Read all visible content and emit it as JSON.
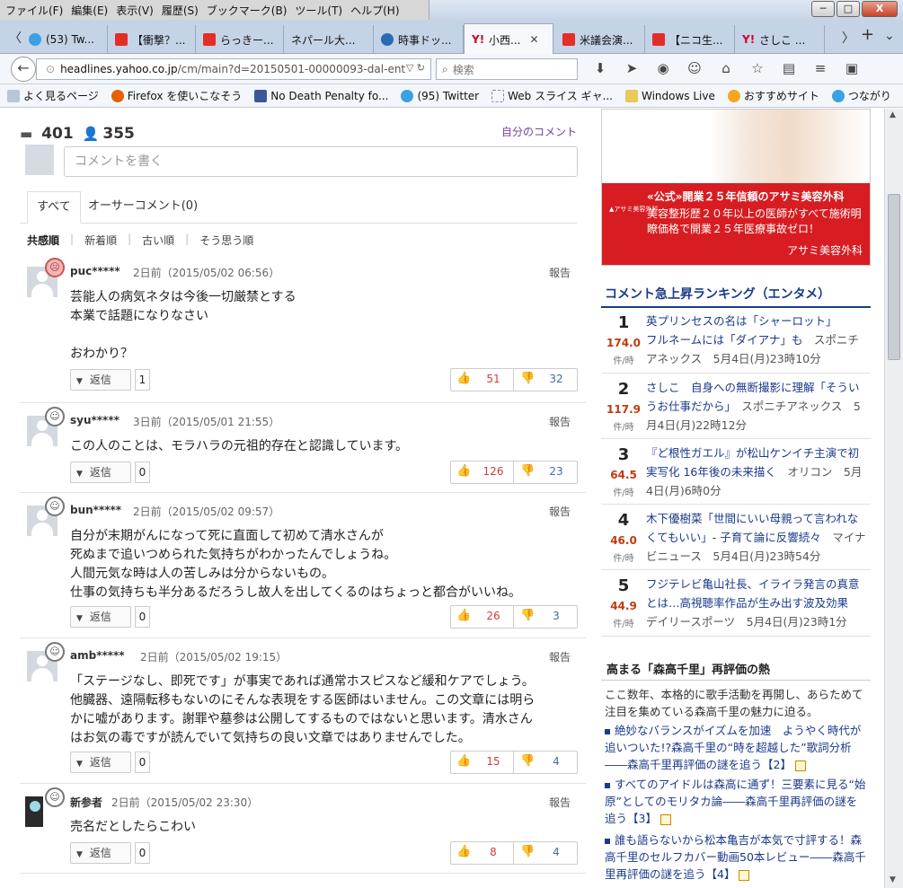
{
  "menu": [
    "ファイル(F)",
    "編集(E)",
    "表示(V)",
    "履歴(S)",
    "ブックマーク(B)",
    "ツール(T)",
    "ヘルプ(H)"
  ],
  "window_buttons": {
    "minimize": "─",
    "maximize": "□",
    "close": "X"
  },
  "tabs": [
    {
      "label": "(53) Tw...",
      "icon": "twitter-icon"
    },
    {
      "label": "【衝撃？...",
      "icon": "youtube-icon"
    },
    {
      "label": "らっきー...",
      "icon": "youtube-icon"
    },
    {
      "label": "ネパール大...",
      "icon": "none"
    },
    {
      "label": "時事ドッ...",
      "icon": "jiji-icon"
    },
    {
      "label": "小西...",
      "icon": "yahoo-icon",
      "active": true
    },
    {
      "label": "米議会演...",
      "icon": "youtube-icon"
    },
    {
      "label": "【ニコ生...",
      "icon": "youtube-icon"
    },
    {
      "label": "さしこ ...",
      "icon": "yahoo-icon"
    }
  ],
  "tab_nav": {
    "left": "〈",
    "right": "〉",
    "new_tab": "+",
    "list": "⌄"
  },
  "url": {
    "host": "headlines.yahoo.co.jp",
    "path": "/cm/main?d=20150501-00000093-dal-ent"
  },
  "search_placeholder": "検索",
  "bookmarks": [
    {
      "label": "よく見るページ",
      "icon": "gear-icon"
    },
    {
      "label": "Firefox を使いこなそう",
      "icon": "firefox-icon"
    },
    {
      "label": "No Death Penalty fo...",
      "icon": "facebook-icon"
    },
    {
      "label": "(95) Twitter",
      "icon": "twitter-icon"
    },
    {
      "label": "Web スライス ギャ...",
      "icon": "webslice-icon"
    },
    {
      "label": "Windows Live",
      "icon": "folder-icon"
    },
    {
      "label": "おすすめサイト",
      "icon": "bulb-icon"
    },
    {
      "label": "つながり",
      "icon": "twitter-icon"
    }
  ],
  "stats": {
    "comments": "401",
    "users": "355"
  },
  "my_comment": "自分のコメント",
  "comment_placeholder": "コメントを書く",
  "comment_tabs": [
    "すべて",
    "オーサーコメント(0)"
  ],
  "sort": [
    "共感順",
    "新着順",
    "古い順",
    "そう思う順"
  ],
  "reply_label": "返信",
  "report_label": "報告",
  "comments": [
    {
      "user": "puc*****",
      "meta": "2日前（2015/05/02 06:56）",
      "text": "芸能人の病気ネタは今後一切厳禁とする\n本業で話題になりなさい\n\nおわかり？",
      "replies": "1",
      "up": "51",
      "down": "32",
      "mood": "angry"
    },
    {
      "user": "syu*****",
      "meta": "3日前（2015/05/01 21:55）",
      "text": "この人のことは、モラハラの元祖的存在と認識しています。",
      "replies": "0",
      "up": "126",
      "down": "23",
      "mood": "smile"
    },
    {
      "user": "bun*****",
      "meta": "2日前（2015/05/02 09:57）",
      "text": "自分が末期がんになって死に直面して初めて清水さんが\n死ぬまで追いつめられた気持ちがわかったんでしょうね。\n人間元気な時は人の苦しみは分からないもの。\n仕事の気持ちも半分あるだろうし故人を出してくるのはちょっと都合がいいね。",
      "replies": "0",
      "up": "26",
      "down": "3",
      "mood": "smile"
    },
    {
      "user": "amb*****",
      "meta": "2日前（2015/05/02 19:15）",
      "text": "「ステージなし、即死です」が事実であれば通常ホスピスなど緩和ケアでしょう。\n他臓器、遠隔転移もないのにそんな表現をする医師はいません。この文章には明ら\nかに嘘があります。謝罪や墓参は公開してするものではないと思います。清水さん\nはお気の毒ですが読んでいて気持ちの良い文章ではありませんでした。",
      "replies": "0",
      "up": "15",
      "down": "4",
      "mood": "smile"
    },
    {
      "user": "新参者",
      "meta": "2日前（2015/05/02 23:30）",
      "text": "売名だとしたらこわい",
      "replies": "0",
      "up": "8",
      "down": "4",
      "mood": "smile"
    }
  ],
  "ad": {
    "headline": "«公式»開業２５年信頼のアサミ美容外科",
    "text": "美容整形歴２０年以上の医師がすべて施術明瞭価格で開業２５年医療事故ゼロ！",
    "brand": "アサミ美容外科",
    "logo": "▲アサミ美容外科"
  },
  "ranking": {
    "title": "コメント急上昇ランキング（エンタメ）",
    "unit": "件/時",
    "items": [
      {
        "rank": "1",
        "speed": "174.0",
        "title": "英プリンセスの名は「シャーロット」\nフルネームには「ダイアナ」も",
        "source": "スポニチアネックス　5月4日(月)23時10分"
      },
      {
        "rank": "2",
        "speed": "117.9",
        "title": "さしこ　自身への無断撮影に理解「そういうお仕事だから」",
        "source": "スポニチアネックス　5月4日(月)22時12分"
      },
      {
        "rank": "3",
        "speed": "64.5",
        "title": "『ど根性ガエル』が松山ケンイチ主演で初実写化 16年後の未来描く",
        "source": "オリコン　5月4日(月)6時0分"
      },
      {
        "rank": "4",
        "speed": "46.0",
        "title": "木下優樹菜「世間にいい母親って言われなくてもいい」- 子育て論に反響続々",
        "source": "マイナビニュース　5月4日(月)23時54分"
      },
      {
        "rank": "5",
        "speed": "44.9",
        "title": "フジテレビ亀山社長、イライラ発言の真意とは…高視聴率作品が生み出す波及効果",
        "source": "デイリースポーツ　5月4日(月)23時1分"
      }
    ]
  },
  "special": {
    "title": "高まる「森高千里」再評価の熱",
    "desc": "ここ数年、本格的に歌手活動を再開し、あらためて注目を集めている森高千里の魅力に迫る。",
    "links": [
      "絶妙なバランスがイズムを加速　ようやく時代が追いついた!?森高千里の“時を超越した”歌詞分析――森高千里再評価の謎を追う【2】",
      "すべてのアイドルは森高に通ず！三要素に見る“始原”としてのモリタカ論――森高千里再評価の謎を追う【3】",
      "誰も語らないから松本亀吉が本気で寸評する！森高千里のセルフカバー動画50本レビュー――森高千里再評価の謎を追う【4】"
    ]
  }
}
